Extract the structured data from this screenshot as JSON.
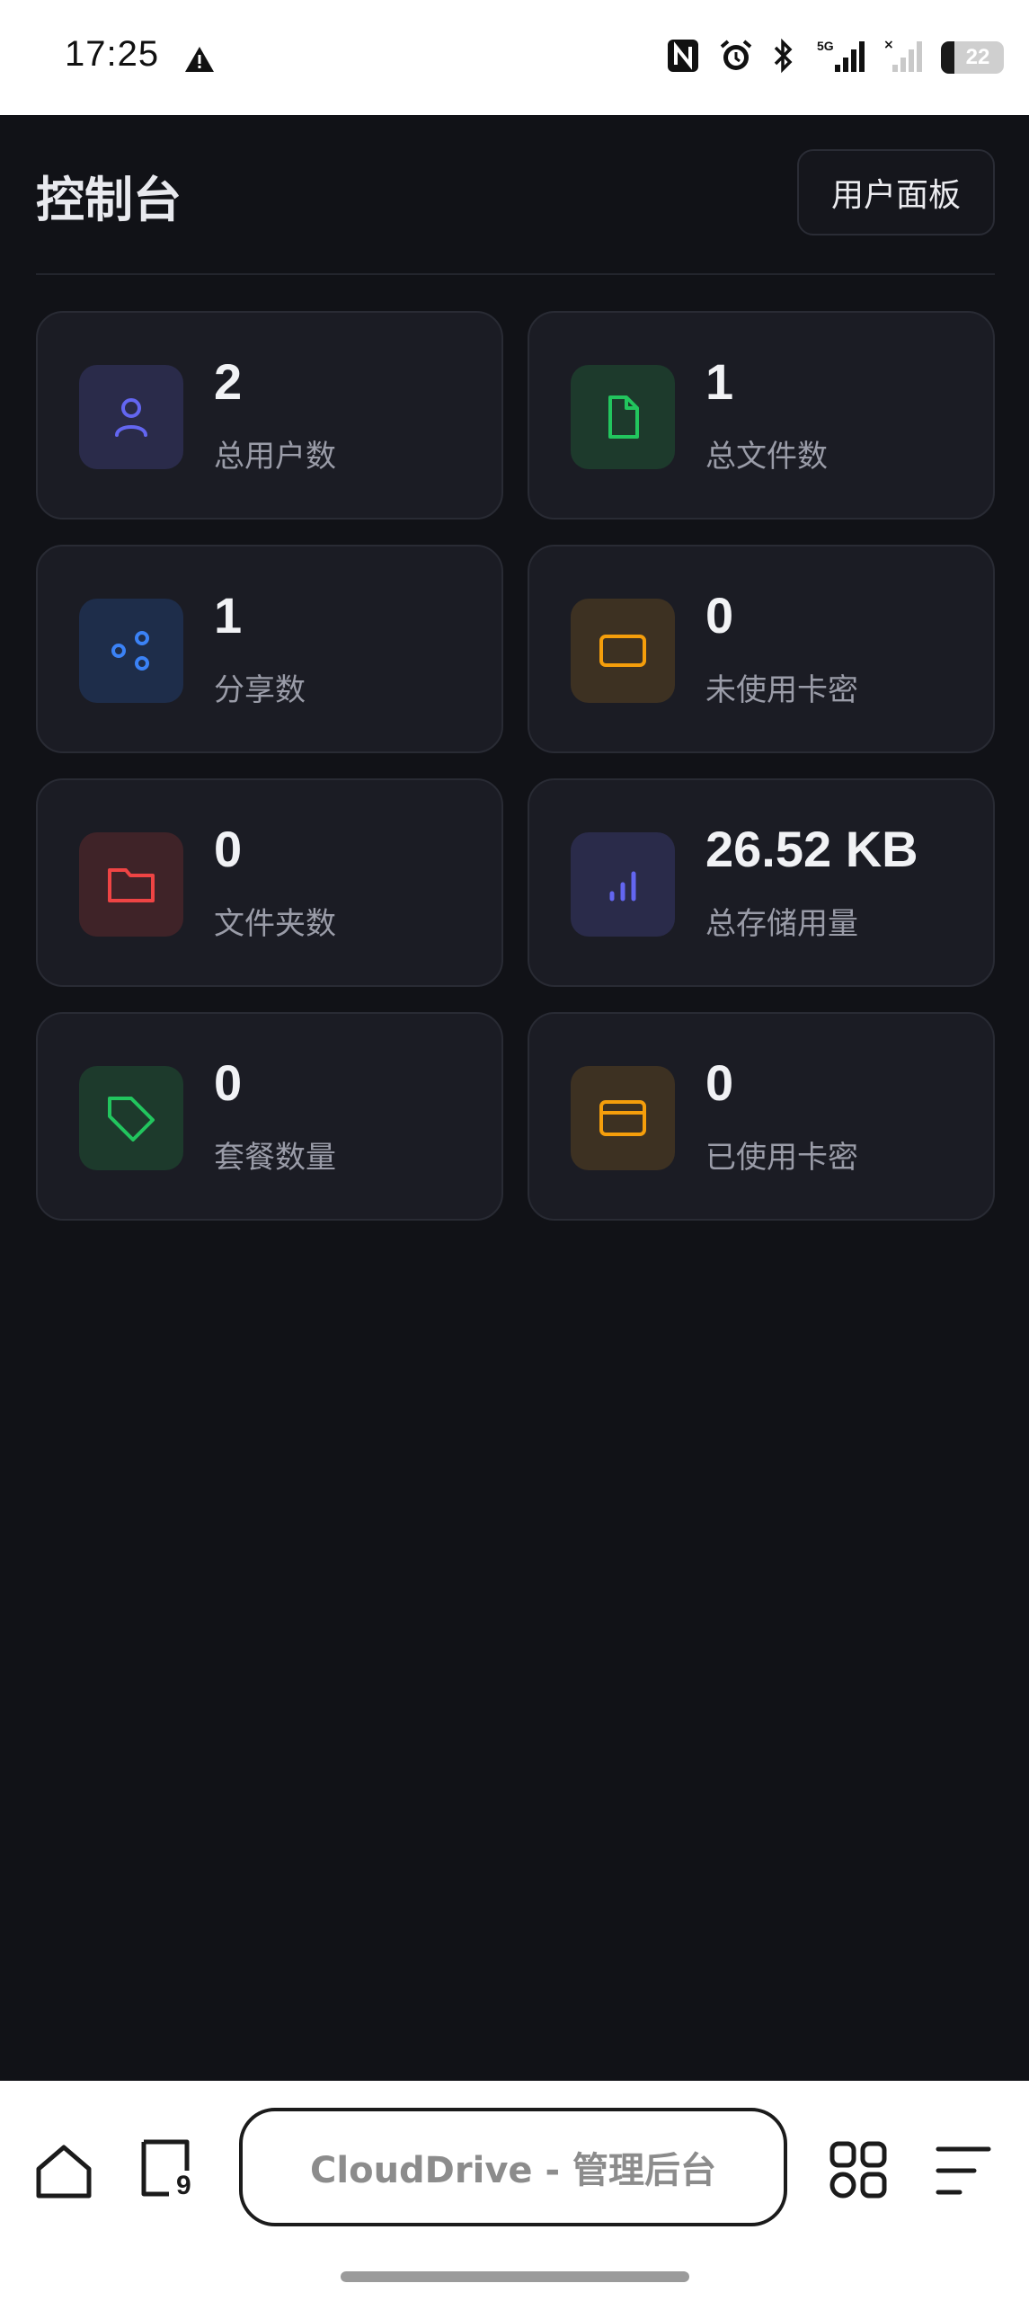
{
  "status_bar": {
    "time": "17:25",
    "battery": "22",
    "battery_level": 0.22
  },
  "header": {
    "title": "控制台",
    "user_panel_button": "用户面板"
  },
  "stats": [
    {
      "value": "2",
      "label": "总用户数",
      "icon": "user-icon",
      "color": "#6366f1",
      "bg": "#2a2b4a"
    },
    {
      "value": "1",
      "label": "总文件数",
      "icon": "file-icon",
      "color": "#22c55e",
      "bg": "#1d3a2c"
    },
    {
      "value": "1",
      "label": "分享数",
      "icon": "share-icon",
      "color": "#3b82f6",
      "bg": "#1e2d4a"
    },
    {
      "value": "0",
      "label": "未使用卡密",
      "icon": "card-icon",
      "color": "#f59e0b",
      "bg": "#3d3122"
    },
    {
      "value": "0",
      "label": "文件夹数",
      "icon": "folder-icon",
      "color": "#ef4444",
      "bg": "#3f2328"
    },
    {
      "value": "26.52 KB",
      "label": "总存储用量",
      "icon": "bar-chart-icon",
      "color": "#6366f1",
      "bg": "#2a2b4a"
    },
    {
      "value": "0",
      "label": "套餐数量",
      "icon": "tag-icon",
      "color": "#22c55e",
      "bg": "#1d3a2c"
    },
    {
      "value": "0",
      "label": "已使用卡密",
      "icon": "credit-card-icon",
      "color": "#f59e0b",
      "bg": "#3d3122"
    }
  ],
  "browser": {
    "url_title": "CloudDrive - 管理后台",
    "tab_count": "9"
  }
}
